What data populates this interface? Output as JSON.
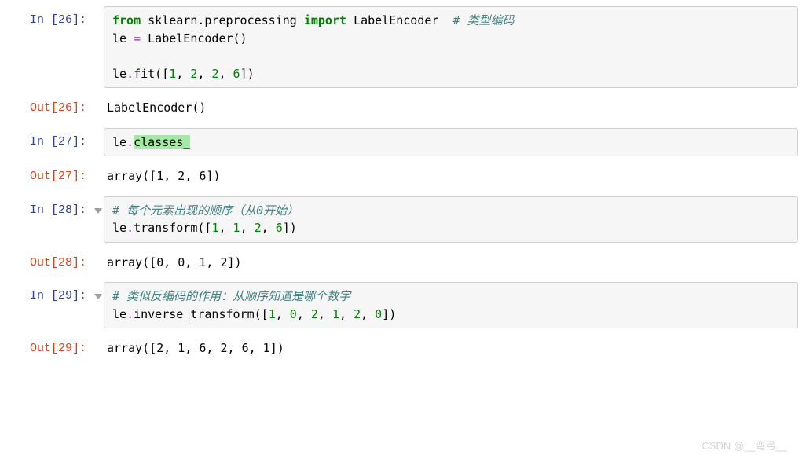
{
  "cells": [
    {
      "in_label": "In [26]:",
      "out_label": "Out[26]:",
      "collapser": false,
      "code_tokens": [
        {
          "t": "from",
          "c": "kw"
        },
        {
          "t": " "
        },
        {
          "t": "sklearn.preprocessing",
          "c": "nm"
        },
        {
          "t": " "
        },
        {
          "t": "import",
          "c": "kw"
        },
        {
          "t": " "
        },
        {
          "t": "LabelEncoder",
          "c": "nm"
        },
        {
          "t": "  "
        },
        {
          "t": "# 类型编码",
          "c": "cmt"
        },
        {
          "br": true
        },
        {
          "t": "le ",
          "c": "nm"
        },
        {
          "t": "=",
          "c": "op"
        },
        {
          "t": " LabelEncoder()",
          "c": "nm"
        },
        {
          "br": true
        },
        {
          "br": true
        },
        {
          "t": "le",
          "c": "nm"
        },
        {
          "t": ".",
          "c": "op"
        },
        {
          "t": "fit([",
          "c": "nm"
        },
        {
          "t": "1",
          "c": "num"
        },
        {
          "t": ", "
        },
        {
          "t": "2",
          "c": "num"
        },
        {
          "t": ", "
        },
        {
          "t": "2",
          "c": "num"
        },
        {
          "t": ", "
        },
        {
          "t": "6",
          "c": "num"
        },
        {
          "t": "])",
          "c": "nm"
        }
      ],
      "output": "LabelEncoder()"
    },
    {
      "in_label": "In [27]:",
      "out_label": "Out[27]:",
      "collapser": false,
      "code_tokens": [
        {
          "t": "le",
          "c": "nm"
        },
        {
          "t": ".",
          "c": "op"
        },
        {
          "t": "classes_",
          "c": "nm hl"
        }
      ],
      "output": "array([1, 2, 6])"
    },
    {
      "in_label": "In [28]:",
      "out_label": "Out[28]:",
      "collapser": true,
      "code_tokens": [
        {
          "t": "# 每个元素出现的顺序（从0开始）",
          "c": "cmt"
        },
        {
          "br": true
        },
        {
          "t": "le",
          "c": "nm"
        },
        {
          "t": ".",
          "c": "op"
        },
        {
          "t": "transform([",
          "c": "nm"
        },
        {
          "t": "1",
          "c": "num"
        },
        {
          "t": ", "
        },
        {
          "t": "1",
          "c": "num"
        },
        {
          "t": ", "
        },
        {
          "t": "2",
          "c": "num"
        },
        {
          "t": ", "
        },
        {
          "t": "6",
          "c": "num"
        },
        {
          "t": "])",
          "c": "nm"
        }
      ],
      "output": "array([0, 0, 1, 2])"
    },
    {
      "in_label": "In [29]:",
      "out_label": "Out[29]:",
      "collapser": true,
      "code_tokens": [
        {
          "t": "# 类似反编码的作用：从顺序知道是哪个数字",
          "c": "cmt"
        },
        {
          "br": true
        },
        {
          "t": "le",
          "c": "nm"
        },
        {
          "t": ".",
          "c": "op"
        },
        {
          "t": "inverse_transform([",
          "c": "nm"
        },
        {
          "t": "1",
          "c": "num"
        },
        {
          "t": ", "
        },
        {
          "t": "0",
          "c": "num"
        },
        {
          "t": ", "
        },
        {
          "t": "2",
          "c": "num"
        },
        {
          "t": ", "
        },
        {
          "t": "1",
          "c": "num"
        },
        {
          "t": ", "
        },
        {
          "t": "2",
          "c": "num"
        },
        {
          "t": ", "
        },
        {
          "t": "0",
          "c": "num"
        },
        {
          "t": "])",
          "c": "nm"
        }
      ],
      "output": "array([2, 1, 6, 2, 6, 1])"
    }
  ],
  "watermark": "CSDN @__弯弓__"
}
